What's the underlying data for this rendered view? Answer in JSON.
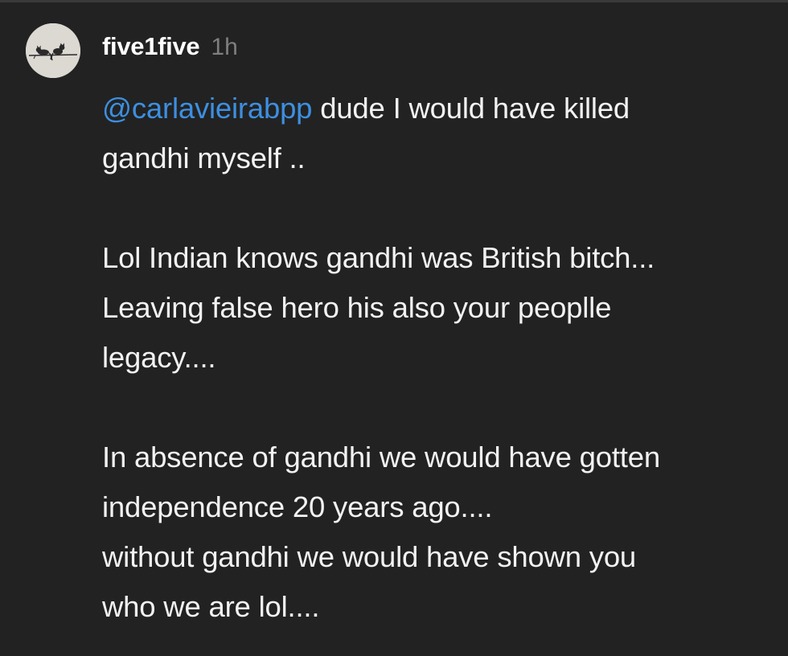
{
  "comment": {
    "username": "five1five",
    "timestamp": "1h",
    "mention": "@carlavieirabpp",
    "lines": [
      " dude I would have killed",
      "gandhi myself  ..",
      "",
      "Lol Indian knows gandhi was British bitch...",
      "Leaving false hero his also your peoplle",
      "legacy....",
      "",
      "In absence of gandhi we would have gotten",
      "independence 20 years ago....",
      "without gandhi we would have shown you",
      "who we are lol...."
    ]
  },
  "colors": {
    "background": "#222222",
    "mention": "#3d8fe0",
    "timestamp": "#7f7f7f",
    "text": "#f2f2f2"
  }
}
